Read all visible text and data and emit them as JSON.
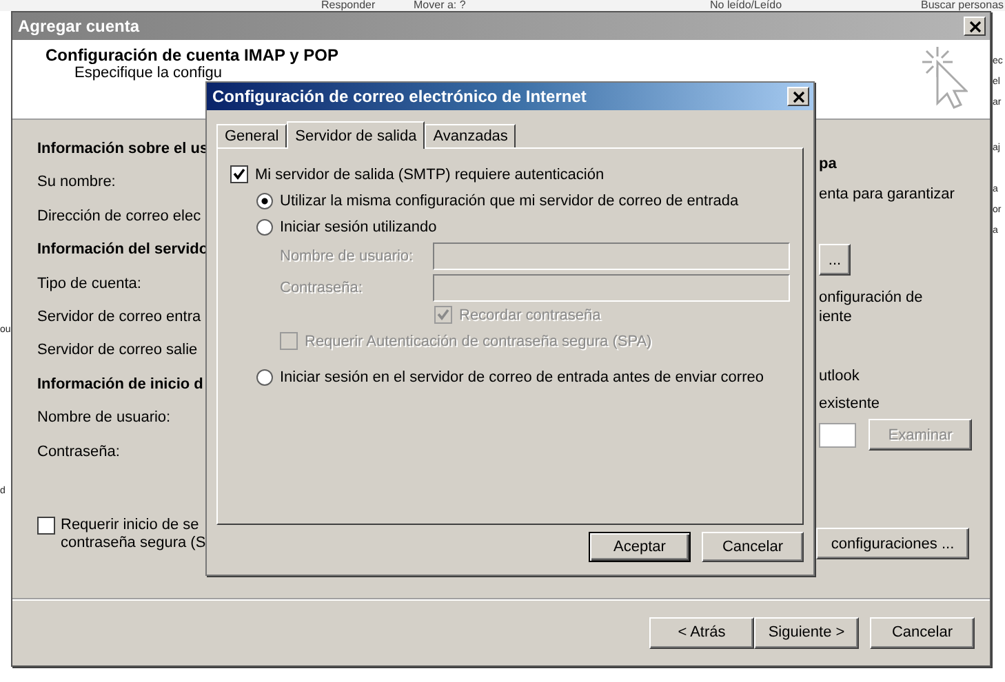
{
  "background_app": {
    "toolbar": [
      "Responder",
      "Mover a: ?",
      "No leído/Leído",
      "Buscar personas"
    ],
    "right_edge": [
      "ec",
      "el",
      "ar",
      "aj",
      "a",
      "or",
      "a"
    ],
    "left_edge": [
      "ou",
      "d"
    ]
  },
  "account_dialog": {
    "title": "Agregar cuenta",
    "header": {
      "title": "Configuración de cuenta IMAP y POP",
      "subtitle": "Especifique la configu"
    },
    "left_items": [
      {
        "kind": "heading",
        "text": "Información sobre el us"
      },
      {
        "kind": "label",
        "text": "Su nombre:"
      },
      {
        "kind": "label",
        "text": "Dirección de correo elec"
      },
      {
        "kind": "heading",
        "text": "Información del servido"
      },
      {
        "kind": "label",
        "text": "Tipo de cuenta:"
      },
      {
        "kind": "label",
        "text": "Servidor de correo entra"
      },
      {
        "kind": "label",
        "text": "Servidor de correo salie"
      },
      {
        "kind": "heading",
        "text": "Información de inicio d"
      },
      {
        "kind": "label",
        "text": "Nombre de usuario:"
      },
      {
        "kind": "label",
        "text": "Contraseña:"
      }
    ],
    "require_checkbox": {
      "lines": [
        "Requerir inicio de se",
        "contraseña segura (S"
      ],
      "checked": false
    },
    "right_items": [
      {
        "kind": "heading",
        "text": "pa"
      },
      {
        "kind": "text",
        "text": "enta para garantizar"
      },
      {
        "kind": "button",
        "text": "..."
      },
      {
        "kind": "text",
        "text": "onfiguración de"
      },
      {
        "kind": "text",
        "text": "iente"
      },
      {
        "kind": "text",
        "text": "utlook"
      },
      {
        "kind": "text",
        "text": "existente"
      },
      {
        "kind": "field_button",
        "text": "Examinar",
        "disabled": true
      },
      {
        "kind": "button",
        "text": "configuraciones ..."
      }
    ],
    "buttons": [
      "< Atrás",
      "Siguiente >",
      "Cancelar"
    ]
  },
  "internet_dialog": {
    "title": "Configuración de correo electrónico de Internet",
    "tabs": [
      {
        "label": "General",
        "selected": false
      },
      {
        "label": "Servidor de salida",
        "selected": true
      },
      {
        "label": "Avanzadas",
        "selected": false
      }
    ],
    "auth_checkbox": {
      "label": "Mi servidor de salida (SMTP) requiere autenticación",
      "checked": true
    },
    "radios": [
      {
        "label": "Utilizar la misma configuración que mi servidor de correo de entrada",
        "selected": true
      },
      {
        "label": "Iniciar sesión utilizando",
        "selected": false
      }
    ],
    "fields": [
      {
        "label": "Nombre de usuario:",
        "disabled": true
      },
      {
        "label": "Contraseña:",
        "disabled": true
      }
    ],
    "remember_checkbox": {
      "label": "Recordar contraseña",
      "checked": true,
      "disabled": true
    },
    "spa_checkbox": {
      "label": "Requerir Autenticación de contraseña segura (SPA)",
      "checked": false,
      "disabled": true
    },
    "last_radio": {
      "label": "Iniciar sesión en el servidor de correo de entrada antes de enviar correo",
      "selected": false
    },
    "buttons": [
      {
        "label": "Aceptar",
        "default": true
      },
      {
        "label": "Cancelar",
        "default": false
      }
    ]
  }
}
